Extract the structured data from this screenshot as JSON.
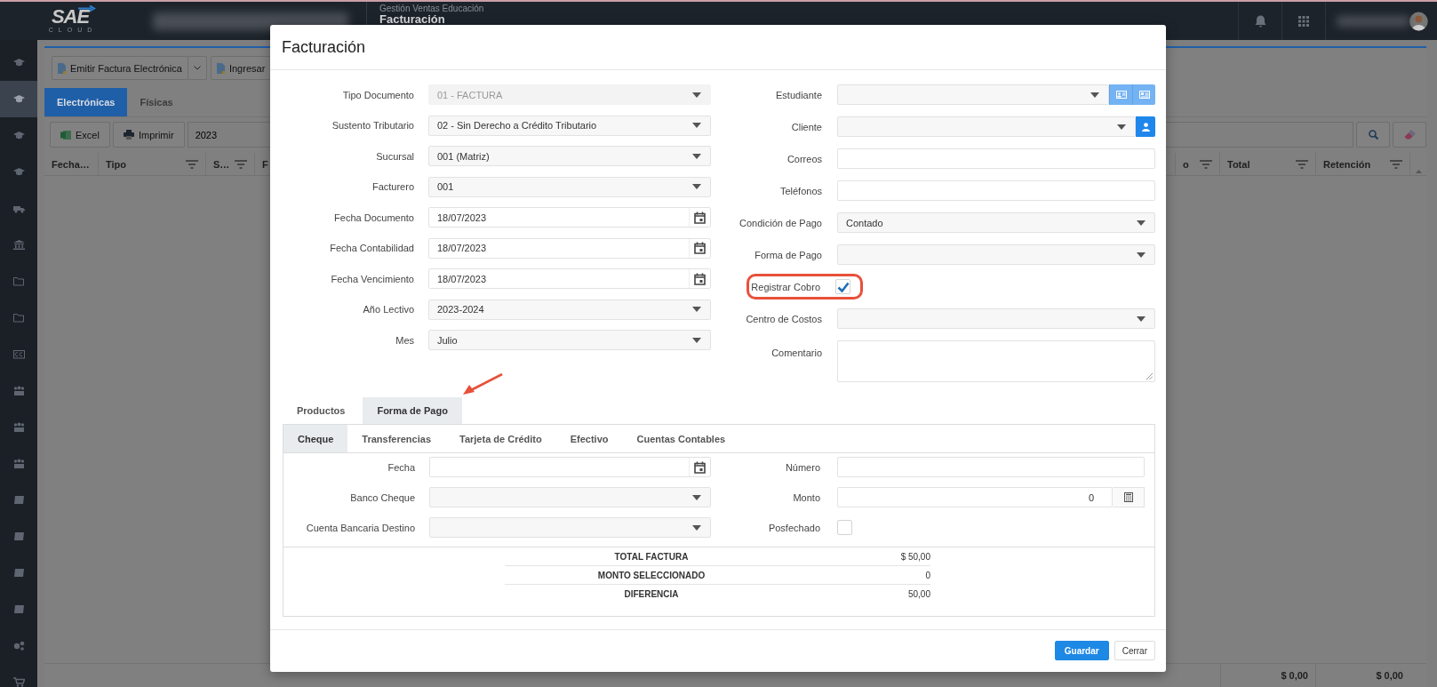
{
  "topbar": {
    "logo": {
      "text": "SAE",
      "subtext": "CLOUD"
    },
    "module": "Gestión Ventas Educación",
    "page_title": "Facturación"
  },
  "sidebar": {
    "items": [
      {
        "selected": false
      },
      {
        "selected": true
      },
      {
        "selected": false
      },
      {
        "selected": false
      },
      {
        "selected": false
      },
      {
        "selected": false
      },
      {
        "selected": false
      },
      {
        "selected": false
      },
      {
        "selected": false
      },
      {
        "selected": false
      },
      {
        "selected": false
      },
      {
        "selected": false
      },
      {
        "selected": false
      },
      {
        "selected": false
      },
      {
        "selected": false
      },
      {
        "selected": false
      },
      {
        "selected": false
      },
      {
        "selected": false
      }
    ]
  },
  "background": {
    "actions": [
      {
        "label": "Emitir Factura Electrónica",
        "has_menu": true
      },
      {
        "label": "Ingresar",
        "has_menu": false
      }
    ],
    "tabs": [
      {
        "label": "Electrónicas",
        "selected": true
      },
      {
        "label": "Físicas",
        "selected": false
      }
    ],
    "buttons": [
      "Excel",
      "Imprimir"
    ],
    "year_field": {
      "value": "2023"
    },
    "columns_left": [
      "Fecha…",
      "Tipo",
      "S…",
      "F"
    ],
    "columns_right": [
      "o",
      "Total",
      "Retención"
    ],
    "totals": [
      "$ 0,00",
      "$ 0,00"
    ]
  },
  "modal": {
    "title": "Facturación",
    "left_fields": [
      {
        "label": "Tipo Documento",
        "kind": "select",
        "value": "01 - FACTURA",
        "disabled": true
      },
      {
        "label": "Sustento Tributario",
        "kind": "select",
        "value": "02 - Sin Derecho a Crédito Tributario",
        "disabled": false
      },
      {
        "label": "Sucursal",
        "kind": "select",
        "value": "001 (Matriz)",
        "disabled": false
      },
      {
        "label": "Facturero",
        "kind": "select",
        "value": "001",
        "disabled": false
      },
      {
        "label": "Fecha Documento",
        "kind": "date",
        "value": "18/07/2023",
        "disabled": false
      },
      {
        "label": "Fecha Contabilidad",
        "kind": "date",
        "value": "18/07/2023",
        "disabled": false
      },
      {
        "label": "Fecha Vencimiento",
        "kind": "date",
        "value": "18/07/2023",
        "disabled": false
      },
      {
        "label": "Año Lectivo",
        "kind": "select",
        "value": "2023-2024",
        "disabled": false
      },
      {
        "label": "Mes",
        "kind": "select",
        "value": "Julio",
        "disabled": false
      }
    ],
    "right_fields": [
      {
        "label": "Estudiante",
        "kind": "lookup",
        "highlighted": false
      },
      {
        "label": "Cliente",
        "kind": "person",
        "highlighted": false
      },
      {
        "label": "Correos",
        "kind": "text",
        "highlighted": false
      },
      {
        "label": "Teléfonos",
        "kind": "text",
        "highlighted": false
      },
      {
        "label": "Condición de Pago",
        "kind": "select",
        "value": "Contado",
        "highlighted": false
      },
      {
        "label": "Forma de Pago",
        "kind": "select",
        "highlighted": false
      },
      {
        "label": "Registrar Cobro",
        "kind": "checkbox",
        "checked": true,
        "highlighted": true
      },
      {
        "label": "Centro de Costos",
        "kind": "select",
        "highlighted": false
      },
      {
        "label": "Comentario",
        "kind": "textarea",
        "highlighted": false
      }
    ],
    "tabs": [
      {
        "label": "Productos",
        "selected": false,
        "arrow": false
      },
      {
        "label": "Forma de Pago",
        "selected": true,
        "arrow": true
      }
    ],
    "subtabs": [
      {
        "label": "Cheque",
        "selected": true
      },
      {
        "label": "Transferencias",
        "selected": false
      },
      {
        "label": "Tarjeta de Crédito",
        "selected": false
      },
      {
        "label": "Efectivo",
        "selected": false
      },
      {
        "label": "Cuentas Contables",
        "selected": false
      }
    ],
    "payment_left": [
      {
        "label": "Fecha",
        "kind": "date"
      },
      {
        "label": "Banco Cheque",
        "kind": "select"
      },
      {
        "label": "Cuenta Bancaria Destino",
        "kind": "select"
      }
    ],
    "payment_right": [
      {
        "label": "Número",
        "kind": "text"
      },
      {
        "label": "Monto",
        "kind": "amount",
        "value": "0"
      },
      {
        "label": "Posfechado",
        "kind": "checkbox",
        "checked": false
      }
    ],
    "summary": [
      {
        "label": "TOTAL FACTURA",
        "value": "$ 50,00"
      },
      {
        "label": "MONTO SELECCIONADO",
        "value": "0"
      },
      {
        "label": "DIFERENCIA",
        "value": "50,00"
      }
    ],
    "footer_buttons": [
      {
        "label": "Guardar",
        "kind": "primary"
      },
      {
        "label": "Cerrar",
        "kind": "secondary"
      }
    ]
  }
}
